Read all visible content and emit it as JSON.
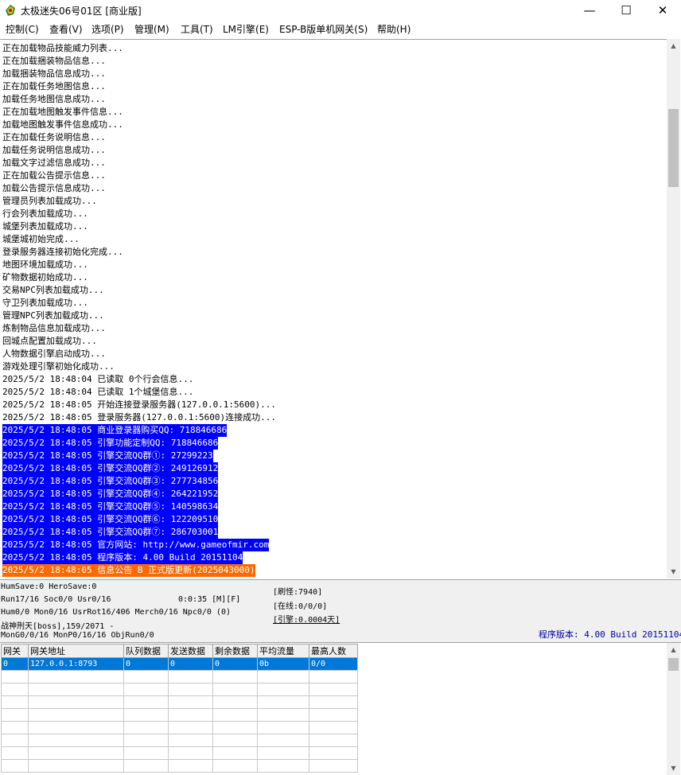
{
  "window": {
    "title": "太极迷失06号01区 [商业版]",
    "minimize_glyph": "—",
    "maximize_glyph": "☐",
    "close_glyph": "✕"
  },
  "menu": [
    "控制(C)",
    "查看(V)",
    "选项(P)",
    "管理(M)",
    "工具(T)",
    "LM引擎(E)",
    "ESP-B版单机网关(S)",
    "帮助(H)"
  ],
  "log": [
    {
      "text": "正在加载物品技能威力列表...",
      "hl": ""
    },
    {
      "text": "正在加载捆装物品信息...",
      "hl": ""
    },
    {
      "text": "加载捆装物品信息成功...",
      "hl": ""
    },
    {
      "text": "正在加载任务地图信息...",
      "hl": ""
    },
    {
      "text": "加载任务地图信息成功...",
      "hl": ""
    },
    {
      "text": "正在加载地图触发事件信息...",
      "hl": ""
    },
    {
      "text": "加载地图触发事件信息成功...",
      "hl": ""
    },
    {
      "text": "正在加载任务说明信息...",
      "hl": ""
    },
    {
      "text": "加载任务说明信息成功...",
      "hl": ""
    },
    {
      "text": "加载文字过滤信息成功...",
      "hl": ""
    },
    {
      "text": "正在加载公告提示信息...",
      "hl": ""
    },
    {
      "text": "加载公告提示信息成功...",
      "hl": ""
    },
    {
      "text": "管理员列表加载成功...",
      "hl": ""
    },
    {
      "text": "行会列表加载成功...",
      "hl": ""
    },
    {
      "text": "城堡列表加载成功...",
      "hl": ""
    },
    {
      "text": "城堡城初始完成...",
      "hl": ""
    },
    {
      "text": "登录服务器连接初始化完成...",
      "hl": ""
    },
    {
      "text": "地图环境加载成功...",
      "hl": ""
    },
    {
      "text": "矿物数据初始成功...",
      "hl": ""
    },
    {
      "text": "交易NPC列表加载成功...",
      "hl": ""
    },
    {
      "text": "守卫列表加载成功...",
      "hl": ""
    },
    {
      "text": "管理NPC列表加载成功...",
      "hl": ""
    },
    {
      "text": "炼制物品信息加载成功...",
      "hl": ""
    },
    {
      "text": "回城点配置加载成功...",
      "hl": ""
    },
    {
      "text": "人物数据引擎启动成功...",
      "hl": ""
    },
    {
      "text": "游戏处理引擎初始化成功...",
      "hl": ""
    },
    {
      "text": "2025/5/2 18:48:04 已读取 0个行会信息...",
      "hl": ""
    },
    {
      "text": "2025/5/2 18:48:04 已读取 1个城堡信息...",
      "hl": ""
    },
    {
      "text": "2025/5/2 18:48:05 开始连接登录服务器(127.0.0.1:5600)...",
      "hl": ""
    },
    {
      "text": "2025/5/2 18:48:05 登录服务器(127.0.0.1:5600)连接成功...",
      "hl": ""
    },
    {
      "text": "2025/5/2 18:48:05 商业登录器购买QQ: 718846686",
      "hl": "blue"
    },
    {
      "text": "2025/5/2 18:48:05 引擎功能定制QQ: 718846686",
      "hl": "blue"
    },
    {
      "text": "2025/5/2 18:48:05 引擎交流QQ群①: 27299223",
      "hl": "blue"
    },
    {
      "text": "2025/5/2 18:48:05 引擎交流QQ群②: 249126912",
      "hl": "blue"
    },
    {
      "text": "2025/5/2 18:48:05 引擎交流QQ群③: 277734856",
      "hl": "blue"
    },
    {
      "text": "2025/5/2 18:48:05 引擎交流QQ群④: 264221952",
      "hl": "blue"
    },
    {
      "text": "2025/5/2 18:48:05 引擎交流QQ群⑤: 140598634",
      "hl": "blue"
    },
    {
      "text": "2025/5/2 18:48:05 引擎交流QQ群⑥: 122209510",
      "hl": "blue"
    },
    {
      "text": "2025/5/2 18:48:05 引擎交流QQ群⑦: 286703001",
      "hl": "blue"
    },
    {
      "text": "2025/5/2 18:48:05 官方网站: http://www.gameofmir.com",
      "hl": "blue"
    },
    {
      "text": "2025/5/2 18:48:05 程序版本: 4.00 Build 20151104",
      "hl": "blue"
    },
    {
      "text": "2025/5/2 18:48:05 信息公告 B 正式版更新(2025043000)",
      "hl": "orange"
    }
  ],
  "status": {
    "line1": "HumSave:0 HeroSave:0",
    "line2a": "Run17/16 Soc0/0 Usr0/16",
    "line2b": "0:0:35 [M][F]",
    "line3": "Hum0/0 Mon0/16 UsrRot16/406 Merch0/16 Npc0/0 (0)",
    "line4": "战神刑天[boss],159/2071 -",
    "line5": "MonG0/0/16 MonP0/16/16 ObjRun0/0",
    "brush": "[刷怪:7940]",
    "online": "[在线:0/0/0]",
    "engine": "[引擎:0.0004天]",
    "version": "程序版本: 4.00 Build 20151104",
    "version_color": "#0000a0"
  },
  "gateway": {
    "columns": [
      "网关",
      "网关地址",
      "队列数据",
      "发送数据",
      "剩余数据",
      "平均流量",
      "最高人数"
    ],
    "rows": [
      [
        "0",
        "127.0.0.1:8793",
        "0",
        "0",
        "0",
        "0b",
        "0/0"
      ]
    ],
    "selected_color": "#0078d7"
  }
}
